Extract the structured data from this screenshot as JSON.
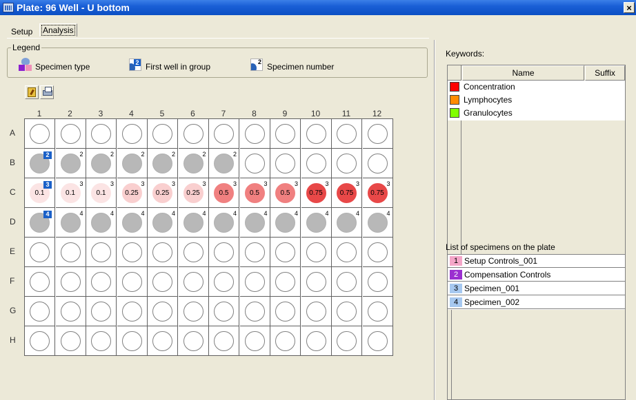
{
  "window": {
    "title": "Plate: 96 Well - U bottom",
    "close_label": "×"
  },
  "tabs": [
    {
      "label": "Setup"
    },
    {
      "label": "Analysis"
    }
  ],
  "legend": {
    "title": "Legend",
    "items": [
      {
        "label": "Specimen type",
        "icon": "specimen-type-icon"
      },
      {
        "label": "First well in group",
        "icon": "first-well-icon",
        "sample": "2"
      },
      {
        "label": "Specimen number",
        "icon": "specimen-number-icon",
        "sample": "2"
      }
    ]
  },
  "toolbar": {
    "buttons": [
      {
        "icon": "edit-keywords-icon"
      },
      {
        "icon": "print-icon"
      }
    ]
  },
  "plate": {
    "columns": [
      "1",
      "2",
      "3",
      "4",
      "5",
      "6",
      "7",
      "8",
      "9",
      "10",
      "11",
      "12"
    ],
    "rows": [
      "A",
      "B",
      "C",
      "D",
      "E",
      "F",
      "G",
      "H"
    ],
    "filled": {
      "B": {
        "specimen": "2",
        "cols": 7
      },
      "C": {
        "specimen": "3",
        "cols": 12,
        "values": [
          "0.1",
          "0.1",
          "0.1",
          "0.25",
          "0.25",
          "0.25",
          "0.5",
          "0.5",
          "0.5",
          "0.75",
          "0.75",
          "0.75"
        ]
      },
      "D": {
        "specimen": "4",
        "cols": 12
      }
    },
    "concentration_colors": {
      "0.1": "#fbe4e4",
      "0.25": "#f9cfcf",
      "0.5": "#f08080",
      "0.75": "#e84848"
    }
  },
  "keywords": {
    "title": "Keywords:",
    "columns": {
      "name": "Name",
      "suffix": "Suffix"
    },
    "rows": [
      {
        "name": "Concentration",
        "color": "#ff0000"
      },
      {
        "name": "Lymphocytes",
        "color": "#ff8c00"
      },
      {
        "name": "Granulocytes",
        "color": "#80ff00"
      }
    ]
  },
  "specimens": {
    "title": "List of specimens on the plate",
    "rows": [
      {
        "num": "1",
        "name": "Setup Controls_001",
        "color": "#f4a6c8"
      },
      {
        "num": "2",
        "name": "Compensation Controls",
        "color": "#9b2fd0"
      },
      {
        "num": "3",
        "name": "Specimen_001",
        "color": "#a6c8f0"
      },
      {
        "num": "4",
        "name": "Specimen_002",
        "color": "#a6c8f0"
      }
    ]
  }
}
